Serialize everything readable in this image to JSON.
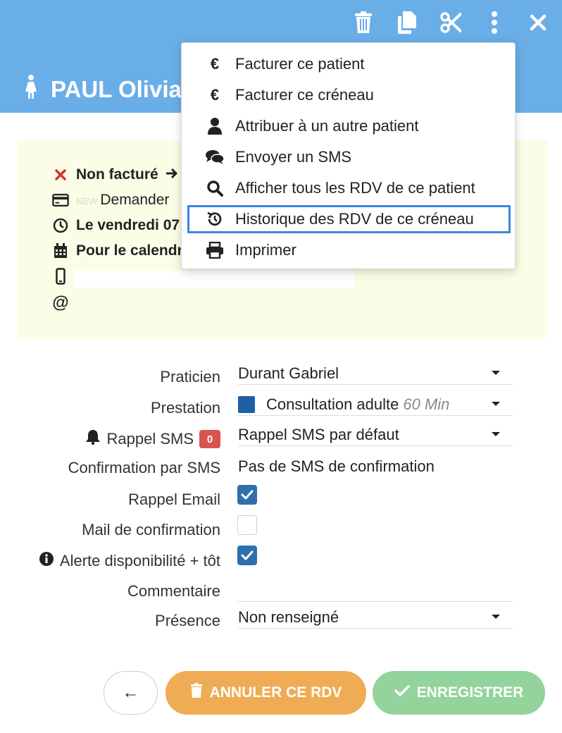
{
  "header": {
    "patient_name": "PAUL Olivia"
  },
  "toolbar": {
    "icons": [
      "trash-icon",
      "copy-icon",
      "scissors-icon",
      "kebab-menu-icon",
      "close-icon"
    ]
  },
  "menu": {
    "items": [
      {
        "label": "Facturer ce patient",
        "icon": "euro-icon"
      },
      {
        "label": "Facturer ce créneau",
        "icon": "euro-icon"
      },
      {
        "label": "Attribuer à un autre patient",
        "icon": "user-icon"
      },
      {
        "label": "Envoyer un SMS",
        "icon": "chat-icon"
      },
      {
        "label": "Afficher tous les RDV de ce patient",
        "icon": "search-icon"
      },
      {
        "label": "Historique des RDV de ce créneau",
        "icon": "history-icon",
        "highlighted": true
      },
      {
        "label": "Imprimer",
        "icon": "print-icon"
      }
    ],
    "highlight_color": "#3b86e0"
  },
  "info": {
    "billing_status": "Non facturé",
    "badge_new": "NEW",
    "request_text": "Demander",
    "date_text": "Le vendredi 07",
    "calendar_text": "Pour le calendr",
    "phone_value": "",
    "email_value": ""
  },
  "form": {
    "praticien": {
      "label": "Praticien",
      "value": "Durant Gabriel"
    },
    "prestation": {
      "label": "Prestation",
      "value": "Consultation adulte",
      "duration": "60 Min",
      "color": "#1f5fa8"
    },
    "rappel_sms": {
      "label": "Rappel SMS",
      "count": "0",
      "value": "Rappel SMS par défaut"
    },
    "confirmation_sms": {
      "label": "Confirmation par SMS",
      "value": "Pas de SMS de confirmation"
    },
    "rappel_email": {
      "label": "Rappel Email",
      "checked": true
    },
    "mail_confirmation": {
      "label": "Mail de confirmation",
      "checked": false
    },
    "alerte": {
      "label": "Alerte disponibilité + tôt",
      "checked": true
    },
    "commentaire": {
      "label": "Commentaire",
      "value": ""
    },
    "presence": {
      "label": "Présence",
      "value": "Non renseigné"
    }
  },
  "buttons": {
    "back": "←",
    "cancel": "ANNULER CE RDV",
    "save": "ENREGISTRER"
  },
  "colors": {
    "header": "#6aaee8",
    "info_bg": "#fbfde6",
    "cancel": "#efac54",
    "save": "#93d39c",
    "checkbox": "#2f6fae",
    "sms_badge": "#d9534f"
  }
}
